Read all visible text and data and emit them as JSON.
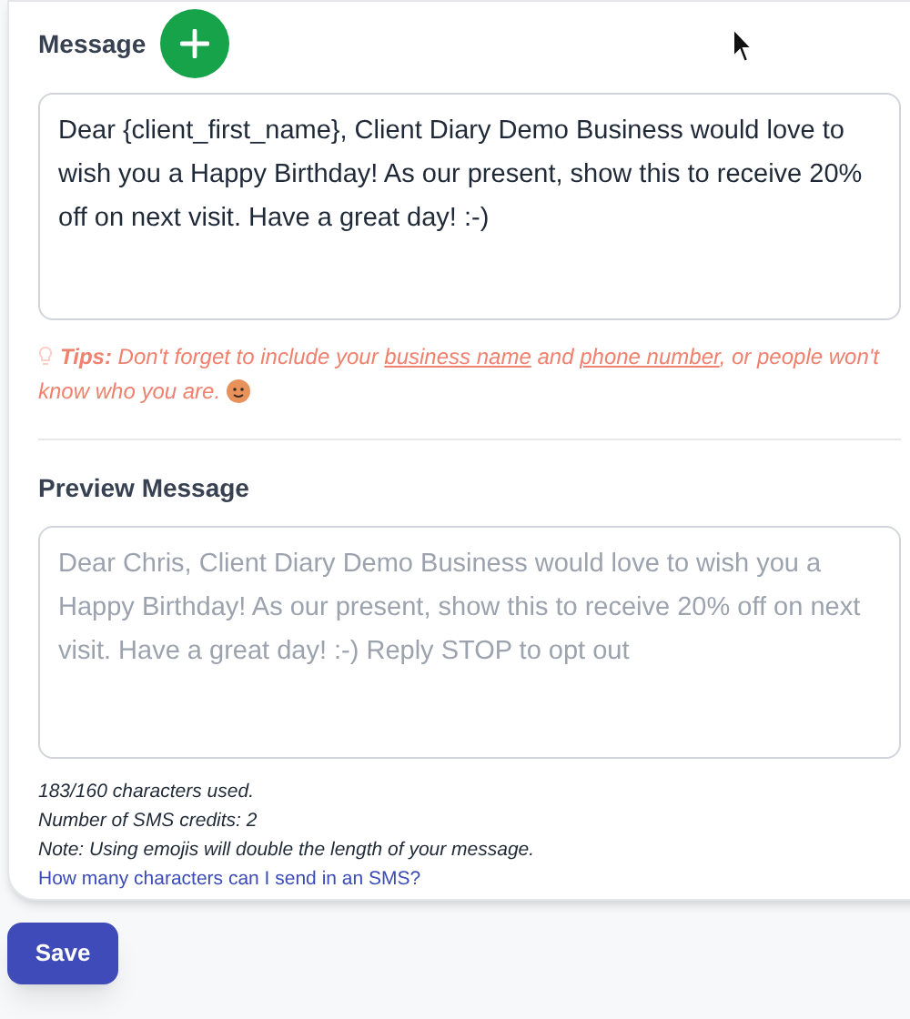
{
  "message": {
    "label": "Message",
    "value": "Dear {client_first_name}, Client Diary Demo Business would love to wish you a Happy Birthday! As our present, show this to receive 20% off on next visit. Have a great day! :-)"
  },
  "tips": {
    "prefix": "**Tips:** Don't forget to include your",
    "link_1": "business name",
    "middle": "and",
    "link_2": "phone number",
    "suffix": ", or people won't know who you are."
  },
  "preview": {
    "label": "Preview Message",
    "placeholder": "Dear Chris, Client Diary Demo Business would love to wish you a Happy Birthday! As our present, show this to receive 20% off on next visit. Have a great day! :-) Reply STOP to opt out"
  },
  "stats": [
    "183/160 characters used.",
    "Number of SMS credits: 2",
    "Note: Using emojis will double the length of your message."
  ],
  "help_link": "How many characters can I send in an SMS?",
  "save_button": "Save"
}
